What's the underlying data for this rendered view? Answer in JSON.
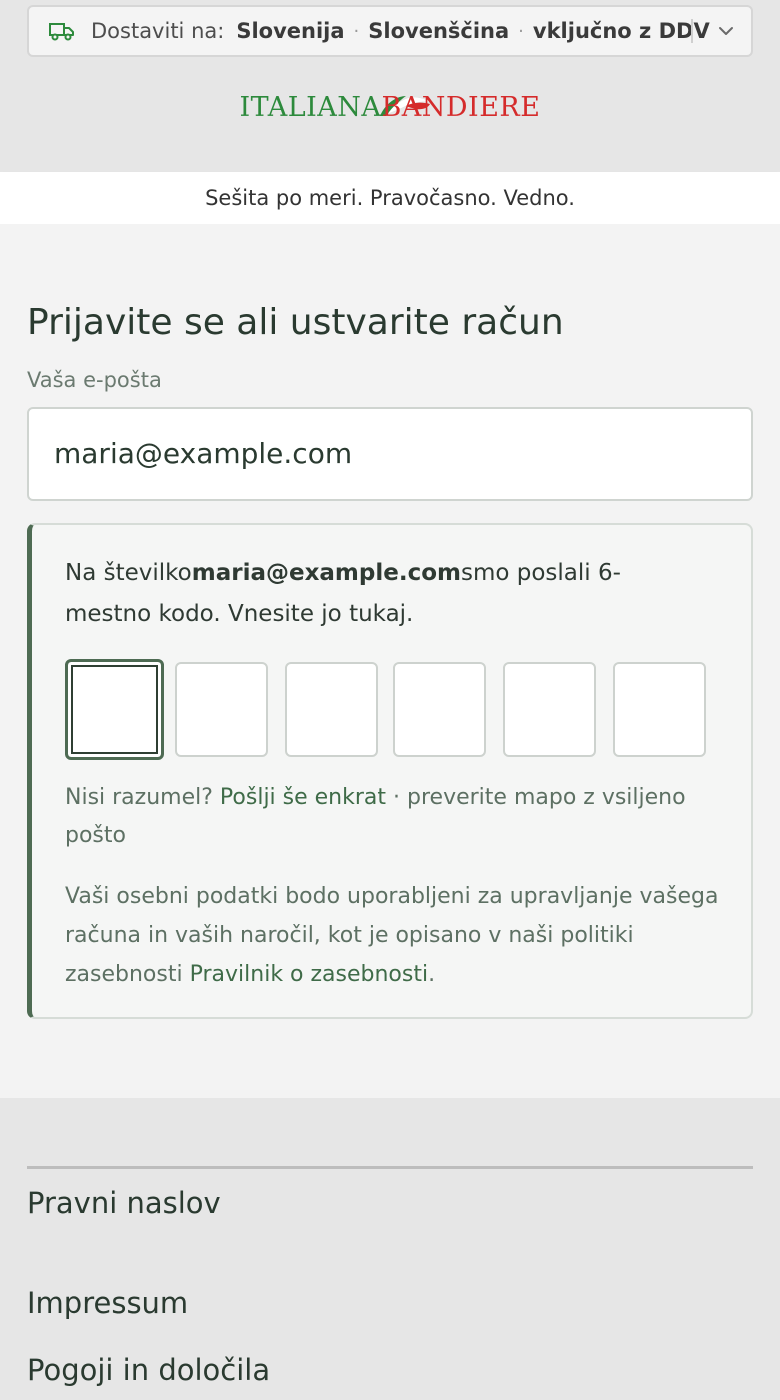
{
  "shipping_bar": {
    "label": "Dostaviti na:",
    "country": "Slovenija",
    "language": "Slovenščina",
    "tax": "vključno z DDV",
    "separator": "·"
  },
  "header": {
    "logo_left": "ITALIANA",
    "logo_right": "BANDIERE",
    "tagline": "Sešita po meri. Pravočasno. Vedno."
  },
  "login": {
    "title": "Prijavite se ali ustvarite račun",
    "email_label": "Vaša e-pošta",
    "email_value": "maria@example.com",
    "code_message_prefix": "Na številko",
    "code_message_email": "maria@example.com",
    "code_message_suffix": "smo poslali 6-mestno kodo. Vnesite jo tukaj.",
    "code_digits": [
      "",
      "",
      "",
      "",
      "",
      ""
    ],
    "resend_prefix": "Nisi razumel?",
    "resend_link": "Pošlji še enkrat",
    "resend_suffix": "· preverite mapo z vsiljeno pošto",
    "privacy_text": "Vaši osebni podatki bodo uporabljeni za upravljanje vašega računa in vaših naročil, kot je opisano v naši politiki zasebnosti",
    "privacy_link": "Pravilnik o zasebnosti",
    "privacy_end": "."
  },
  "footer": {
    "section_title": "Pravni naslov",
    "links": [
      "Impressum",
      "Pogoji in določila"
    ]
  },
  "colors": {
    "accent_green": "#4e6b53",
    "link_green": "#3f6b48",
    "logo_green": "#2d8a3c",
    "logo_red": "#d52b2b"
  },
  "icons": {
    "shipping": "truck-icon",
    "dropdown": "chevron-down-icon",
    "logo_mark": "italian-flag-swoosh"
  }
}
